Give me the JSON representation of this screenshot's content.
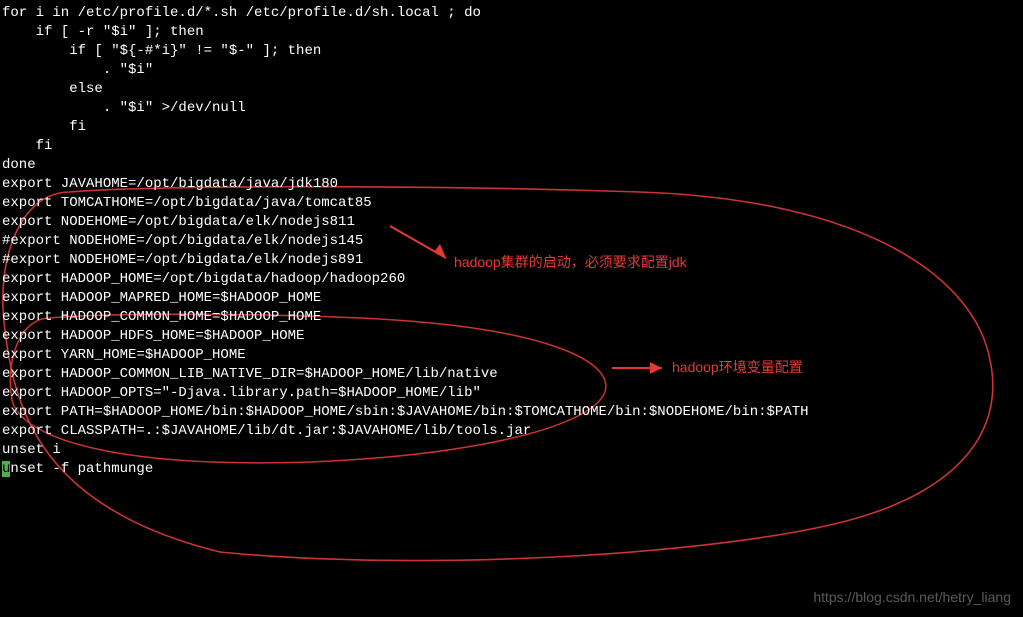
{
  "lines": [
    "for i in /etc/profile.d/*.sh /etc/profile.d/sh.local ; do",
    "    if [ -r \"$i\" ]; then",
    "        if [ \"${-#*i}\" != \"$-\" ]; then",
    "            . \"$i\"",
    "        else",
    "            . \"$i\" >/dev/null",
    "        fi",
    "    fi",
    "done",
    "",
    "export JAVAHOME=/opt/bigdata/java/jdk180",
    "export TOMCATHOME=/opt/bigdata/java/tomcat85",
    "export NODEHOME=/opt/bigdata/elk/nodejs811",
    "#export NODEHOME=/opt/bigdata/elk/nodejs145",
    "#export NODEHOME=/opt/bigdata/elk/nodejs891",
    "",
    "export HADOOP_HOME=/opt/bigdata/hadoop/hadoop260",
    "export HADOOP_MAPRED_HOME=$HADOOP_HOME",
    "export HADOOP_COMMON_HOME=$HADOOP_HOME",
    "export HADOOP_HDFS_HOME=$HADOOP_HOME",
    "export YARN_HOME=$HADOOP_HOME",
    "export HADOOP_COMMON_LIB_NATIVE_DIR=$HADOOP_HOME/lib/native",
    "export HADOOP_OPTS=\"-Djava.library.path=$HADOOP_HOME/lib\"",
    "",
    "",
    "export PATH=$HADOOP_HOME/bin:$HADOOP_HOME/sbin:$JAVAHOME/bin:$TOMCATHOME/bin:$NODEHOME/bin:$PATH",
    "export CLASSPATH=.:$JAVAHOME/lib/dt.jar:$JAVAHOME/lib/tools.jar",
    "",
    "",
    "unset i"
  ],
  "last_line_prefix": "u",
  "last_line_rest": "nset -f pathmunge",
  "annotations": {
    "note1": "hadoop集群的启动，必须要求配置jdk",
    "note2": "hadoop环境变量配置"
  },
  "watermark": "https://blog.csdn.net/hetry_liang"
}
